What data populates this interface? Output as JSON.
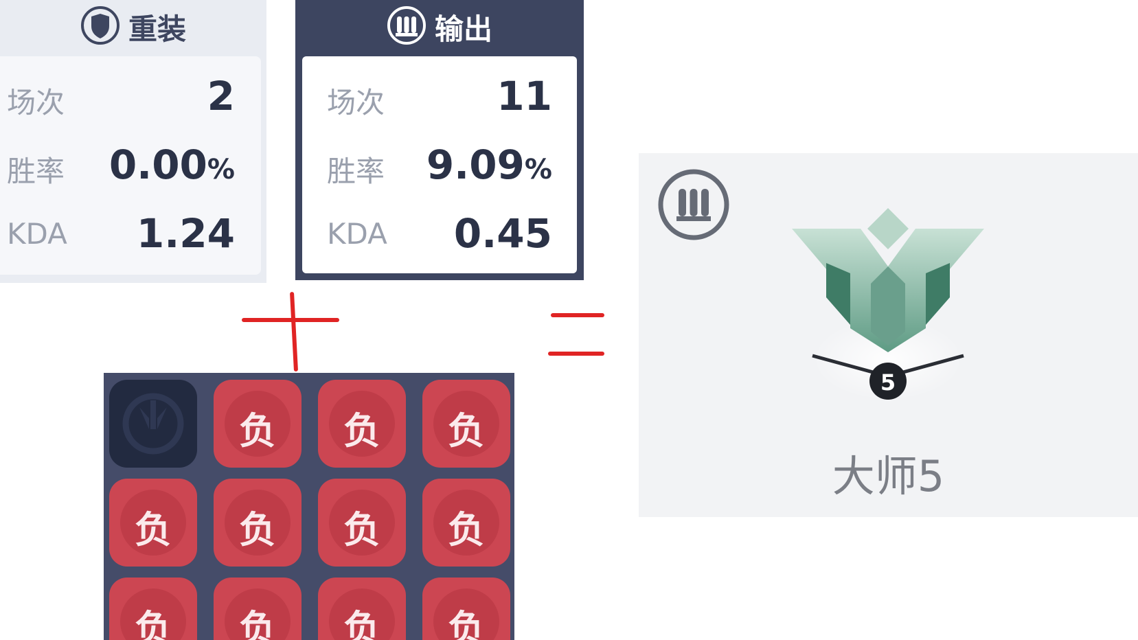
{
  "tank": {
    "role": "重装",
    "stats": [
      {
        "label": "场次",
        "value": "2",
        "unit": ""
      },
      {
        "label": "胜率",
        "value": "0.00",
        "unit": "%"
      },
      {
        "label": "KDA",
        "value": "1.24",
        "unit": ""
      }
    ]
  },
  "damage": {
    "role": "输出",
    "stats": [
      {
        "label": "场次",
        "value": "11",
        "unit": ""
      },
      {
        "label": "胜率",
        "value": "9.09",
        "unit": "%"
      },
      {
        "label": "KDA",
        "value": "0.45",
        "unit": ""
      }
    ]
  },
  "result_grid": {
    "tiles": [
      "",
      "负",
      "负",
      "负",
      "负",
      "负",
      "负",
      "负",
      "负",
      "负",
      "负",
      "负"
    ]
  },
  "rank": {
    "label": "大师5",
    "division": "5"
  },
  "colors": {
    "loss_tile": "#cc4652",
    "card_dark": "#3d4560",
    "annotation_red": "#e02424",
    "rank_green": "#6fa893"
  },
  "icons": {
    "tank": "shield-icon",
    "damage": "bullets-icon",
    "empty_tile": "overwatch-logo-icon",
    "rank": "master-rank-emblem-icon"
  }
}
